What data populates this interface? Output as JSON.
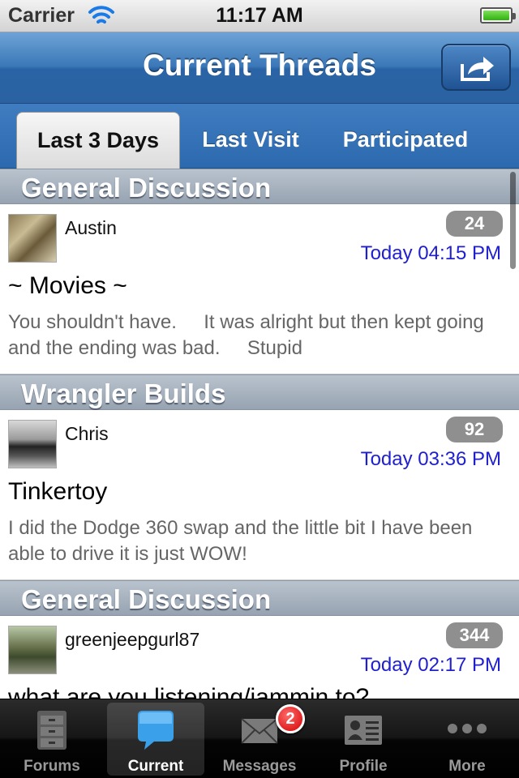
{
  "status_bar": {
    "carrier": "Carrier",
    "time": "11:17 AM"
  },
  "nav": {
    "title": "Current Threads"
  },
  "segments": [
    "Last 3 Days",
    "Last Visit",
    "Participated"
  ],
  "threads": [
    {
      "section": "General Discussion",
      "author": "Austin",
      "replies": "24",
      "time": "Today 04:15 PM",
      "title": "~ Movies ~",
      "preview": "You shouldn't have.     It was alright but then kept going and the ending was bad.     Stupid"
    },
    {
      "section": "Wrangler Builds",
      "author": "Chris",
      "replies": "92",
      "time": "Today 03:36 PM",
      "title": "Tinkertoy",
      "preview": "I did the Dodge 360 swap and the little bit I have been able to drive it is just WOW!"
    },
    {
      "section": "General Discussion",
      "author": "greenjeepgurl87",
      "replies": "344",
      "time": "Today 02:17 PM",
      "title": "what are you listening/jammin to?",
      "preview": ""
    }
  ],
  "tab_bar": {
    "items": [
      {
        "label": "Forums",
        "icon": "cabinet-icon"
      },
      {
        "label": "Current",
        "icon": "speech-bubble-icon"
      },
      {
        "label": "Messages",
        "icon": "envelope-icon",
        "badge": "2"
      },
      {
        "label": "Profile",
        "icon": "profile-card-icon"
      },
      {
        "label": "More",
        "icon": "more-dots-icon"
      }
    ]
  }
}
